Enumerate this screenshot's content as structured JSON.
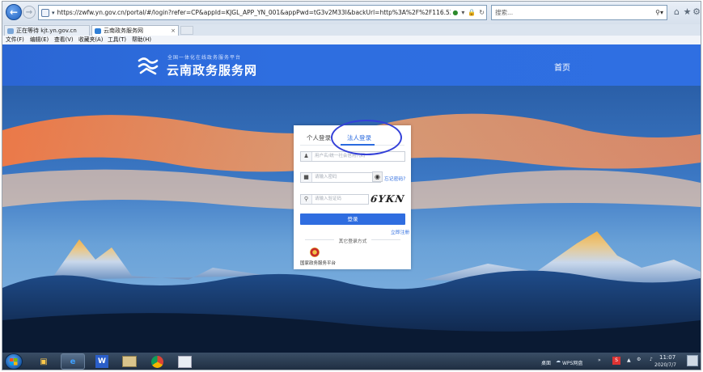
{
  "browser": {
    "url": "https://zwfw.yn.gov.cn/portal/#/login?refer=CP&appId=KJGL_APP_YN_001&appPwd=tG3v2M33I&backUrl=http%3A%2F%2F116.52.249.142%2Fegrantweb",
    "search_placeholder": "搜索...",
    "tabs": [
      {
        "label": "正在等待 kjt.yn.gov.cn"
      },
      {
        "label": "云南政务服务网"
      }
    ],
    "menu": [
      "文件(F)",
      "编辑(E)",
      "查看(V)",
      "收藏夹(A)",
      "工具(T)",
      "帮助(H)"
    ]
  },
  "site": {
    "logo_subtitle": "全国一体化在线政务服务平台",
    "logo_title": "云南政务服务网",
    "nav_home": "首页"
  },
  "login": {
    "tab_personal": "个人登录",
    "tab_legal": "法人登录",
    "username_placeholder": "用户名/统一社会信用代码",
    "password_placeholder": "请输入密码",
    "forgot_password": "忘记密码?",
    "captcha_placeholder": "请输入验证码",
    "captcha_text": "6YKN",
    "login_button": "登录",
    "register_link": "立即注册",
    "other_methods": "其它登录方式",
    "gov_platform": "国家政务服务平台"
  },
  "taskbar": {
    "desktop_label": "桌面",
    "wps_label": "WPS网盘",
    "time": "11:07",
    "date": "2020/7/7"
  },
  "colors": {
    "header_blue": "#2e6ee0",
    "accent_blue": "#2a6adf",
    "annotation_circle": "#3340d8"
  }
}
